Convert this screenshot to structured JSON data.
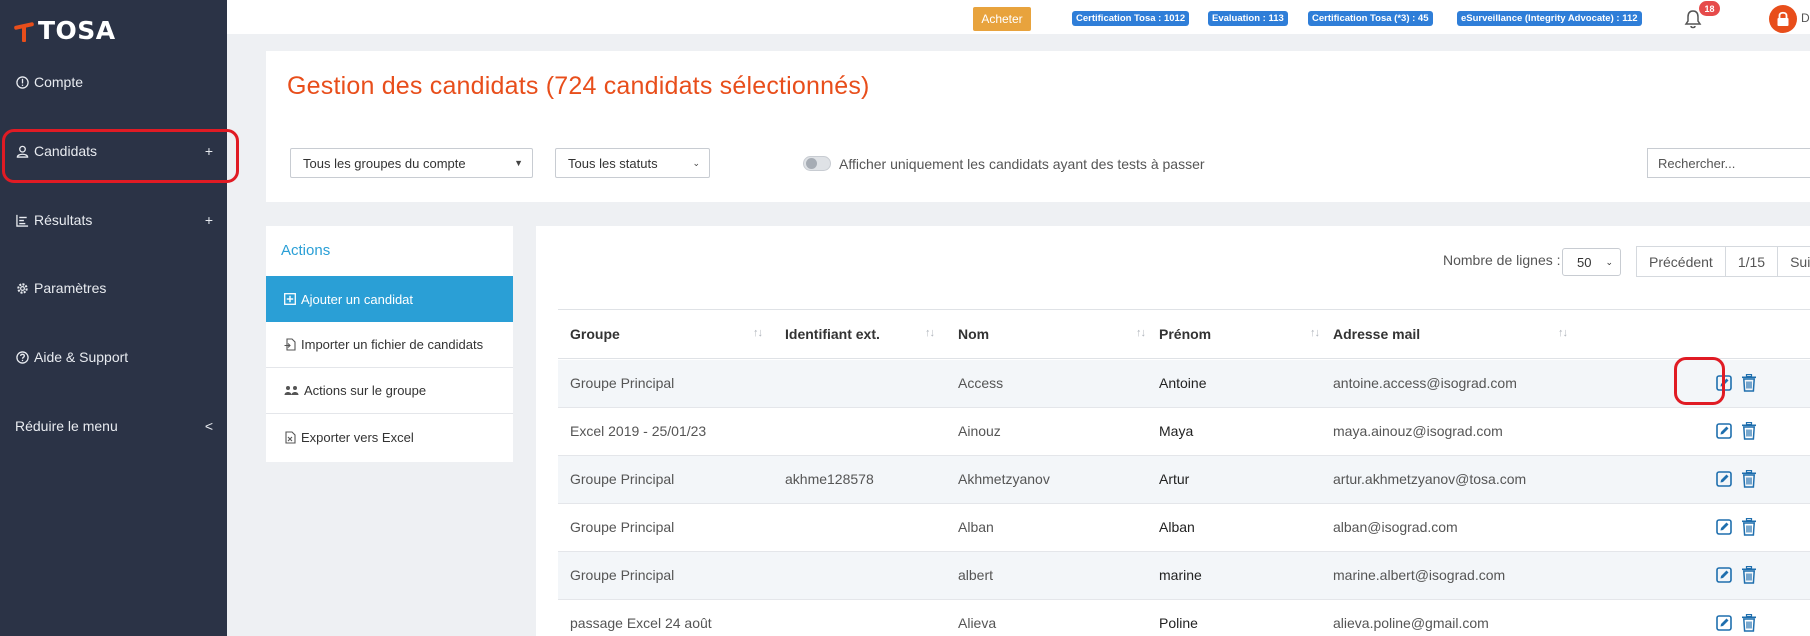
{
  "brand": {
    "name": "TOSA",
    "accent": "#e84e1b"
  },
  "sidebar": {
    "items": [
      {
        "label": "Compte",
        "icon": "info-circle-icon"
      },
      {
        "label": "Candidats",
        "icon": "user-icon",
        "expand": "+"
      },
      {
        "label": "Résultats",
        "icon": "bar-chart-icon",
        "expand": "+"
      },
      {
        "label": "Paramètres",
        "icon": "gear-icon"
      },
      {
        "label": "Aide & Support",
        "icon": "question-circle-icon"
      },
      {
        "label": "Réduire le menu",
        "expand": "<"
      }
    ]
  },
  "topbar": {
    "buy_label": "Acheter",
    "credits": [
      "Certification Tosa : 1012",
      "Evaluation : 113",
      "Certification Tosa (*3) : 45",
      "eSurveillance (Integrity Advocate) : 112"
    ],
    "notifications_count": "18",
    "user_initial": "D"
  },
  "page": {
    "title": "Gestion des candidats (724 candidats sélectionnés)",
    "filters": {
      "group_select": "Tous les groupes du compte",
      "status_select": "Tous les statuts",
      "toggle_label": "Afficher uniquement les candidats ayant des tests à passer",
      "search_placeholder": "Rechercher..."
    }
  },
  "actions": {
    "title": "Actions",
    "items": [
      "Ajouter un candidat",
      "Importer un fichier de candidats",
      "Actions sur le groupe",
      "Exporter vers Excel"
    ]
  },
  "table": {
    "rows_label": "Nombre de lignes :",
    "rows_value": "50",
    "pager": {
      "prev": "Précédent",
      "page": "1/15",
      "next": "Suiv"
    },
    "columns": [
      "Groupe",
      "Identifiant ext.",
      "Nom",
      "Prénom",
      "Adresse mail"
    ],
    "rows": [
      [
        "Groupe Principal",
        "",
        "Access",
        "Antoine",
        "antoine.access@isograd.com"
      ],
      [
        "Excel 2019 - 25/01/23",
        "",
        "Ainouz",
        "Maya",
        "maya.ainouz@isograd.com"
      ],
      [
        "Groupe Principal",
        "akhme128578",
        "Akhmetzyanov",
        "Artur",
        "artur.akhmetzyanov@tosa.com"
      ],
      [
        "Groupe Principal",
        "",
        "Alban",
        "Alban",
        "alban@isograd.com"
      ],
      [
        "Groupe Principal",
        "",
        "albert",
        "marine",
        "marine.albert@isograd.com"
      ],
      [
        "passage Excel 24 août",
        "",
        "Alieva",
        "Poline",
        "alieva.poline@gmail.com"
      ]
    ]
  }
}
